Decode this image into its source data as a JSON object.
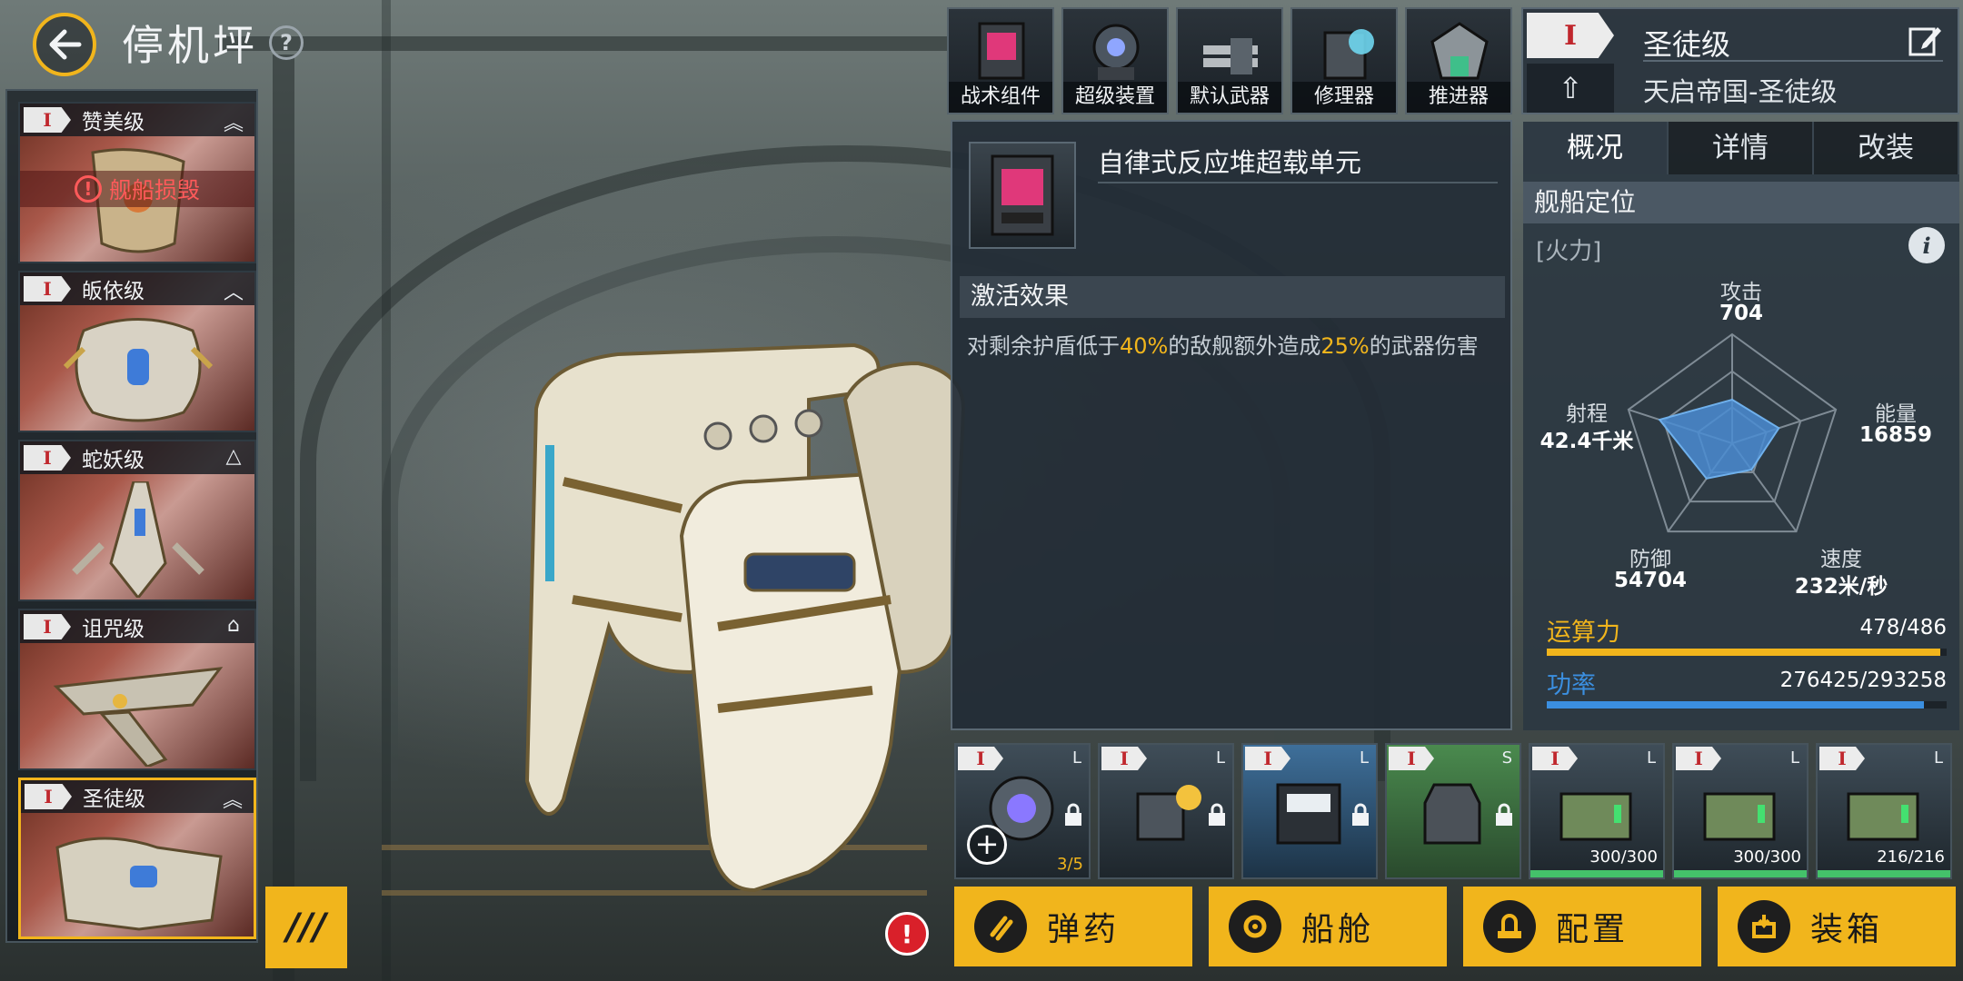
{
  "header": {
    "title": "停机坪",
    "help": "?"
  },
  "ship_list": [
    {
      "tier": "I",
      "name": "赞美级",
      "toggle": "︽",
      "status": "舰船损毁"
    },
    {
      "tier": "I",
      "name": "皈依级",
      "toggle": "︿"
    },
    {
      "tier": "I",
      "name": "蛇妖级",
      "toggle": "△"
    },
    {
      "tier": "I",
      "name": "诅咒级",
      "toggle": "⌂"
    },
    {
      "tier": "I",
      "name": "圣徒级",
      "toggle": "︽",
      "selected": true
    }
  ],
  "equip_tabs": [
    {
      "label": "战术组件",
      "icon": "tactical-component-icon"
    },
    {
      "label": "超级装置",
      "icon": "super-device-icon"
    },
    {
      "label": "默认武器",
      "icon": "default-weapon-icon"
    },
    {
      "label": "修理器",
      "icon": "repairer-icon"
    },
    {
      "label": "推进器",
      "icon": "thruster-icon"
    }
  ],
  "detail": {
    "module_name": "自律式反应堆超载单元",
    "effect_title": "激活效果",
    "effect_parts": [
      "对剩余护盾低于",
      "40%",
      "的敌舰额外造成",
      "25%",
      "的武器伤害"
    ]
  },
  "ship_info": {
    "tier": "I",
    "upgrade_icon": "⇧",
    "name": "圣徒级",
    "subtitle": "天启帝国-圣徒级",
    "tabs": [
      "概况",
      "详情",
      "改装"
    ],
    "position_title": "舰船定位",
    "role": "[火力]",
    "info": "i"
  },
  "radar": {
    "stats": [
      {
        "label": "攻击",
        "value": "704",
        "level": 0.4
      },
      {
        "label": "能量",
        "value": "16859",
        "level": 0.45
      },
      {
        "label": "速度",
        "value": "232米/秒",
        "level": 0.3
      },
      {
        "label": "防御",
        "value": "54704",
        "level": 0.4
      },
      {
        "label": "射程",
        "value": "42.4千米",
        "level": 0.7
      }
    ]
  },
  "bars": [
    {
      "label": "运算力",
      "value": "478/486",
      "fraction": 0.983,
      "color": "#f1b51c"
    },
    {
      "label": "功率",
      "value": "276425/293258",
      "fraction": 0.943,
      "color": "#3b8fe0"
    }
  ],
  "slots": [
    {
      "tier": "I",
      "size": "L",
      "count": "3/5",
      "style": "dark",
      "plus": "+"
    },
    {
      "tier": "I",
      "size": "L",
      "count": "",
      "style": "dark"
    },
    {
      "tier": "I",
      "size": "L",
      "count": "",
      "style": "blue"
    },
    {
      "tier": "I",
      "size": "S",
      "count": "",
      "style": "green"
    },
    {
      "tier": "I",
      "size": "L",
      "count": "300/300",
      "style": "dark",
      "hp": 1.0
    },
    {
      "tier": "I",
      "size": "L",
      "count": "300/300",
      "style": "dark",
      "hp": 1.0
    },
    {
      "tier": "I",
      "size": "L",
      "count": "216/216",
      "style": "dark",
      "hp": 1.0
    }
  ],
  "actions": [
    {
      "label": "弹药",
      "icon": "ammo-icon"
    },
    {
      "label": "船舱",
      "icon": "cabin-icon"
    },
    {
      "label": "配置",
      "icon": "config-icon"
    },
    {
      "label": "装箱",
      "icon": "crate-icon"
    }
  ],
  "menu_icon": "///",
  "warning": "!",
  "colors": {
    "accent": "#f1b51c",
    "tier_red": "#c0272d",
    "power_blue": "#3b8fe0"
  }
}
